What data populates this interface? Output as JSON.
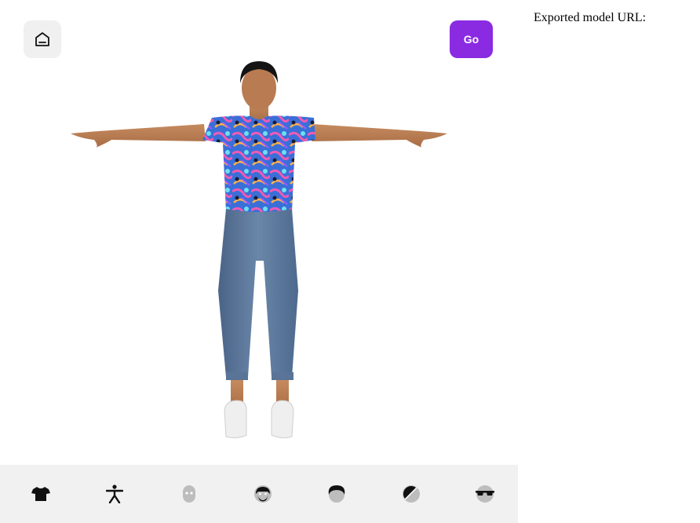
{
  "header": {
    "go_label": "Go"
  },
  "side": {
    "exported_label": "Exported model URL:"
  },
  "icons": {
    "home": "home-icon",
    "go": "go-button",
    "toolbar": [
      "outfit-icon",
      "body-icon",
      "head-icon",
      "face-icon",
      "hair-icon",
      "skin-tone-icon",
      "glasses-icon"
    ]
  },
  "colors": {
    "accent": "#8a2be2",
    "toolbar_bg": "#f1f1f1",
    "home_bg": "#f0f0f0"
  }
}
